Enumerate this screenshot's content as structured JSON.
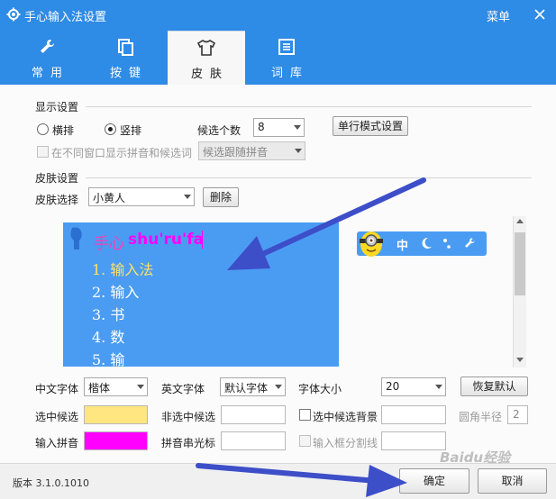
{
  "window": {
    "title": "手心输入法设置",
    "menu_label": "菜单",
    "accent": "#2e8be6"
  },
  "tabs": [
    {
      "label": "常用",
      "icon": "wrench-icon",
      "active": false
    },
    {
      "label": "按键",
      "icon": "keys-icon",
      "active": false
    },
    {
      "label": "皮肤",
      "icon": "tshirt-icon",
      "active": true
    },
    {
      "label": "词库",
      "icon": "book-icon",
      "active": false
    }
  ],
  "display": {
    "section": "显示设置",
    "horizontal": "横排",
    "vertical": "竖排",
    "candidate_count_label": "候选个数",
    "candidate_count_value": "8",
    "single_row_button": "单行模式设置",
    "multiwin_label": "在不同窗口显示拼音和候选词",
    "follow_value": "候选跟随拼音"
  },
  "skin": {
    "section": "皮肤设置",
    "select_label": "皮肤选择",
    "select_value": "小黄人",
    "delete_button": "删除"
  },
  "preview": {
    "logo": "手心",
    "pinyin": "shu'ru'fa",
    "candidates": [
      "1. 输入法",
      "2. 输入",
      "3. 书",
      "4. 数",
      "5. 输"
    ],
    "toolbar_mode": "中",
    "bg": "#4a9cf2",
    "pinyin_color": "#ff00ff",
    "selected_color": "#ffe066"
  },
  "fonts": {
    "cn_label": "中文字体",
    "cn_value": "楷体",
    "en_label": "英文字体",
    "en_value": "默认字体",
    "size_label": "字体大小",
    "size_value": "20",
    "restore_button": "恢复默认"
  },
  "colors": {
    "sel_label": "选中候选",
    "sel_color": "#ffe680",
    "unsel_label": "非选中候选",
    "sel_bg_label": "选中候选背景",
    "radius_label": "圆角半径",
    "radius_value": "2",
    "input_label": "输入拼音",
    "input_color": "#ff00ff",
    "cursor_label": "拼音串光标",
    "divider_label": "输入框分割线"
  },
  "status": {
    "version": "版本 3.1.0.1010",
    "ok": "确定",
    "cancel": "取消"
  },
  "watermark": "Baidu经验"
}
